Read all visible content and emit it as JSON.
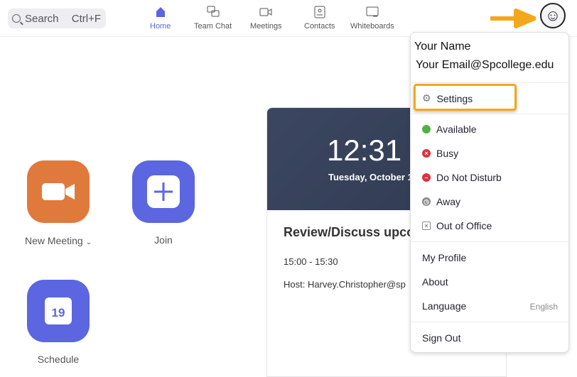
{
  "search": {
    "label": "Search",
    "shortcut": "Ctrl+F"
  },
  "nav": [
    {
      "label": "Home",
      "icon": "home-icon"
    },
    {
      "label": "Team Chat",
      "icon": "chat-icon"
    },
    {
      "label": "Meetings",
      "icon": "video-icon"
    },
    {
      "label": "Contacts",
      "icon": "contacts-icon"
    },
    {
      "label": "Whiteboards",
      "icon": "whiteboard-icon"
    }
  ],
  "colors": {
    "accent": "#5b66e0",
    "orange": "#e07a3c",
    "highlight": "#f4a71c"
  },
  "actions": {
    "new_meeting": "New Meeting",
    "join": "Join",
    "schedule": "Schedule",
    "calendar_day": "19"
  },
  "card": {
    "time": "12:31 P",
    "date": "Tuesday, October 1",
    "title": "Review/Discuss upco",
    "time_range": "15:00 - 15:30",
    "host": "Host: Harvey.Christopher@sp"
  },
  "menu": {
    "name": "Your Name",
    "email": "Your Email@Spcollege.edu",
    "settings": "Settings",
    "status": [
      {
        "label": "Available",
        "color": "#52b142"
      },
      {
        "label": "Busy",
        "color": "#e0303e"
      },
      {
        "label": "Do Not Disturb",
        "color": "#e0303e"
      },
      {
        "label": "Away",
        "color": "#8a8a8a"
      },
      {
        "label": "Out of Office",
        "color": "#8a8a8a"
      }
    ],
    "my_profile": "My Profile",
    "about": "About",
    "language": "Language",
    "language_value": "English",
    "sign_out": "Sign Out"
  }
}
